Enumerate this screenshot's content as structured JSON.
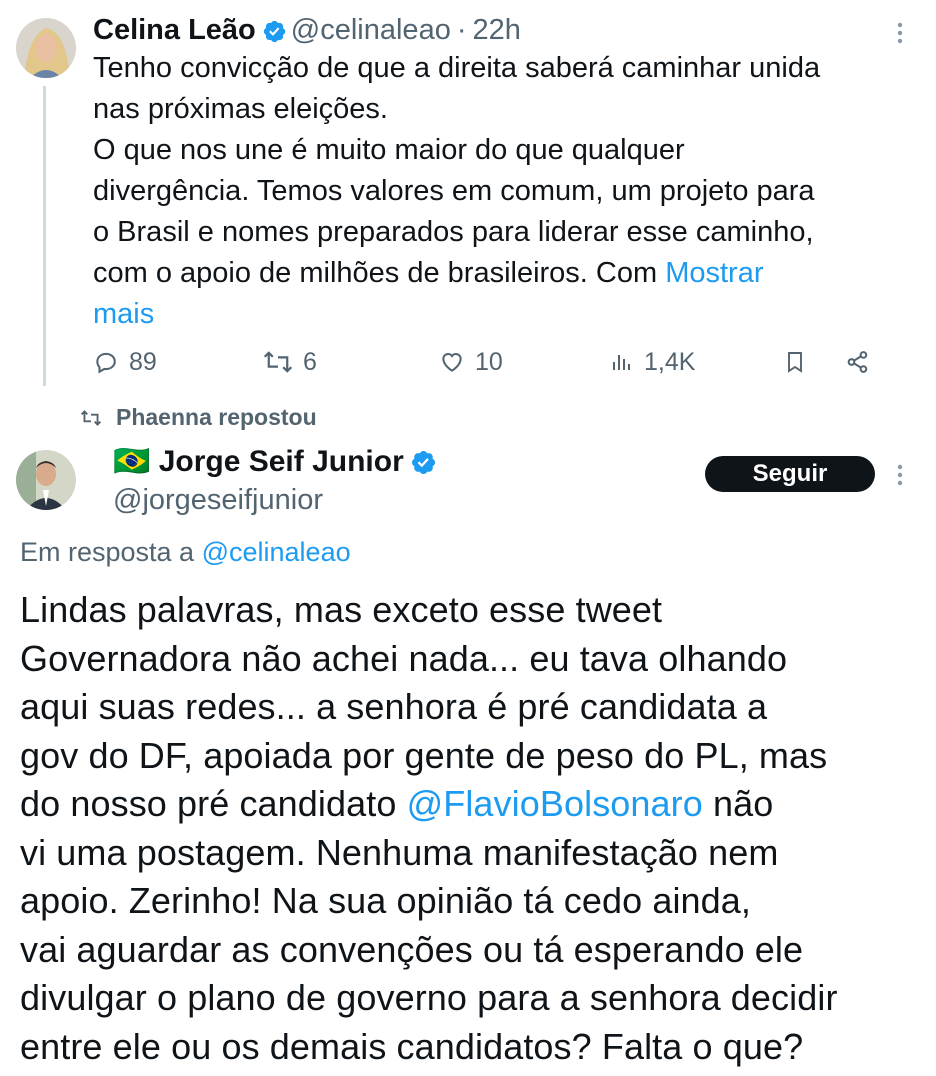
{
  "tweet1": {
    "author_name": "Celina Leão",
    "handle": "@celinaleao",
    "separator": "·",
    "time": "22h",
    "body_lines": [
      "Tenho convicção de que a direita saberá caminhar unida",
      "nas próximas eleições.",
      "O que nos une é muito maior do que qualquer",
      "divergência. Temos valores em comum, um projeto para",
      "o Brasil e nomes preparados para liderar esse caminho,",
      "com o apoio de milhões de brasileiros. Com"
    ],
    "show_more_1": "Mostrar",
    "show_more_2": "mais",
    "replies": "89",
    "retweets": "6",
    "likes": "10",
    "views": "1,4K",
    "icons": [
      "reply-icon",
      "retweet-icon",
      "like-icon",
      "views-icon",
      "bookmark-icon",
      "share-icon",
      "more-icon"
    ]
  },
  "repost_label": "Phaenna repostou",
  "tweet2": {
    "flag": "🇧🇷",
    "author_name": "Jorge Seif Junior",
    "handle": "@jorgeseifjunior",
    "follow_label": "Seguir",
    "reply_prefix": "Em resposta a",
    "reply_handle": "@celinaleao",
    "body": {
      "l1": "Lindas palavras, mas exceto esse tweet",
      "l2": "Governadora não achei nada... eu tava olhando",
      "l3": "aqui suas redes... a senhora é pré candidata a",
      "l4": "gov do DF, apoiada por gente de peso do PL, mas",
      "l5_pre": "do nosso pré candidato",
      "l5_mention": "@FlavioBolsonaro",
      "l5_post": "não",
      "l6": "vi uma postagem. Nenhuma manifestação nem",
      "l7": "apoio. Zerinho! Na sua opinião tá cedo ainda,",
      "l8": "vai aguardar as convenções ou tá esperando ele",
      "l9": "divulgar o plano de governo para a senhora decidir",
      "l10": "entre ele ou os demais candidatos? Falta o que?"
    }
  },
  "colors": {
    "link": "#1d9bf0",
    "verified": "#1d9bf0",
    "muted": "#536471",
    "text": "#0f1419",
    "button_bg": "#0f1419"
  }
}
